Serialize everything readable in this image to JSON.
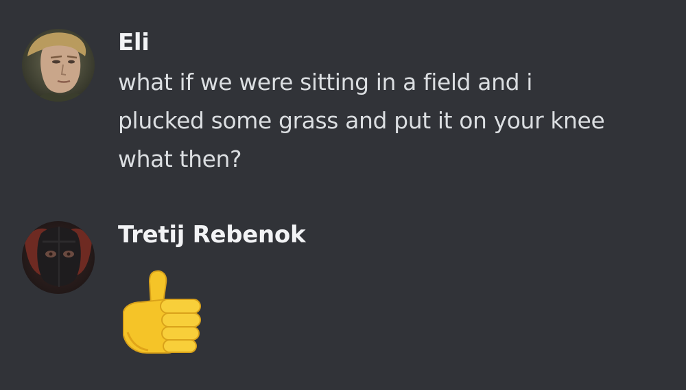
{
  "messages": [
    {
      "author": "Eli",
      "avatar_icon": "user-avatar-eli",
      "lines": [
        "what if we were sitting in a field and i",
        "plucked some grass and put it on your knee",
        "what then?"
      ]
    },
    {
      "author": "Tretij Rebenok",
      "avatar_icon": "user-avatar-tretij",
      "emoji": "thumbs-up-icon"
    }
  ],
  "colors": {
    "background": "#313338",
    "author": "#f2f3f5",
    "text": "#dbdee1",
    "emoji_yellow": "#f5c428"
  }
}
